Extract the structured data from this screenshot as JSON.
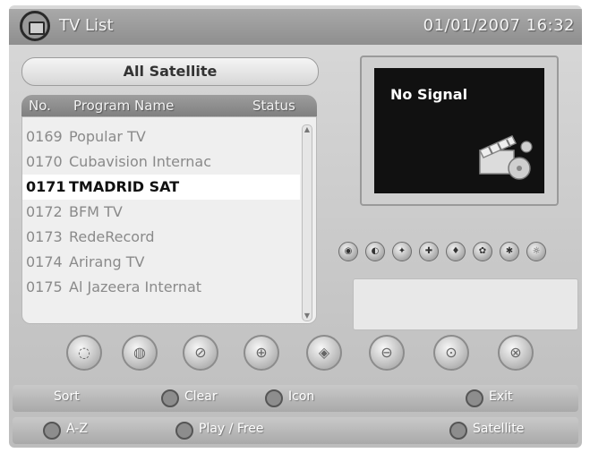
{
  "header": {
    "title": "TV List",
    "datetime": "01/01/2007 16:32",
    "icon": "tv-icon"
  },
  "satellite_selector": {
    "label": "All Satellite"
  },
  "list": {
    "columns": {
      "no": "No.",
      "name": "Program Name",
      "status": "Status"
    },
    "rows": [
      {
        "no": "0169",
        "name": "Popular TV"
      },
      {
        "no": "0170",
        "name": "Cubavision Internac"
      },
      {
        "no": "0171",
        "name": "TMADRID SAT"
      },
      {
        "no": "0172",
        "name": "BFM TV"
      },
      {
        "no": "0173",
        "name": "RedeRecord"
      },
      {
        "no": "0174",
        "name": "Arirang TV"
      },
      {
        "no": "0175",
        "name": "Al Jazeera Internat"
      }
    ],
    "selected_index": 2
  },
  "preview": {
    "status_text": "No Signal",
    "icon": "clapperboard-icon"
  },
  "info": {
    "line1": "",
    "line2": ""
  },
  "keys_row1": [
    {
      "label": "Sort",
      "icon": ""
    },
    {
      "label": "Clear",
      "icon": "key-icon"
    },
    {
      "label": "Icon",
      "icon": "key-icon"
    },
    {
      "label": "Exit",
      "icon": "exit-icon"
    }
  ],
  "keys_row2": [
    {
      "label": "A-Z",
      "icon": "color-key-icon"
    },
    {
      "label": "Play / Free",
      "icon": "color-key-icon"
    },
    {
      "label": "Satellite",
      "icon": "color-key-icon"
    }
  ],
  "colors": {
    "selected_row": "#ffffff",
    "preview_bg": "#111111",
    "bar": "#9a9a9a"
  }
}
